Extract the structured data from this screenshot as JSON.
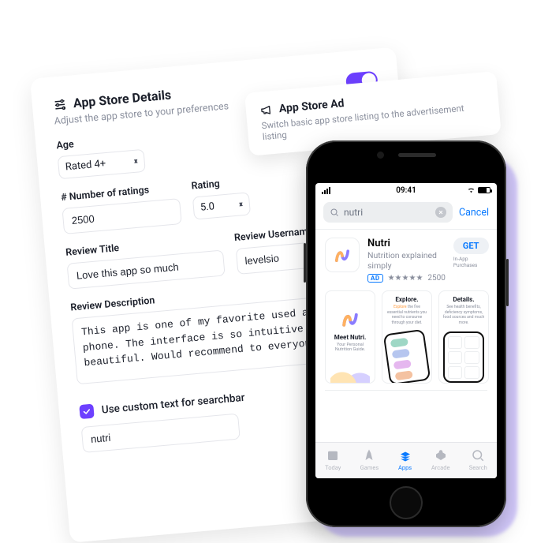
{
  "settings": {
    "title": "App Store Details",
    "subtitle": "Adjust the app store to your preferences",
    "toggle_on": true,
    "age": {
      "label": "Age",
      "value": "Rated 4+"
    },
    "ratings_count": {
      "label": "# Number of ratings",
      "value": "2500"
    },
    "rating": {
      "label": "Rating",
      "value": "5.0"
    },
    "review_title": {
      "label": "Review Title",
      "value": "Love this app so much"
    },
    "review_username": {
      "label": "Review Username",
      "value": "levelsio"
    },
    "review_description": {
      "label": "Review Description",
      "value": "This app is one of my favorite used apps on my phone. The interface is so intuitive and beautiful. Would recommend to everyone!"
    },
    "custom_searchbar": {
      "checked": true,
      "label": "Use custom text for searchbar",
      "value": "nutri"
    }
  },
  "ad_popover": {
    "title": "App Store Ad",
    "subtitle": "Switch basic app store listing to the advertisement listing"
  },
  "phone": {
    "time": "09:41",
    "search": {
      "placeholder": "nutri",
      "cancel": "Cancel"
    },
    "app": {
      "name": "Nutri",
      "tagline": "Nutrition explained simply",
      "ad_badge": "AD",
      "ratings_count": "2500",
      "get": "GET",
      "iap": "In-App Purchases"
    },
    "shots": {
      "s1_title": "Meet Nutri.",
      "s1_sub": "Your Personal Nutrition Guide.",
      "s2_title": "Explore.",
      "s2_sub_pre": "Explore",
      "s2_sub_rest": " the five essential nutrients you need to consume through your diet.",
      "s3_title": "Details.",
      "s3_sub": "See health benefits, deficiency symptoms, food sources and much more."
    },
    "tabs": {
      "today": "Today",
      "games": "Games",
      "apps": "Apps",
      "arcade": "Arcade",
      "search": "Search"
    }
  }
}
